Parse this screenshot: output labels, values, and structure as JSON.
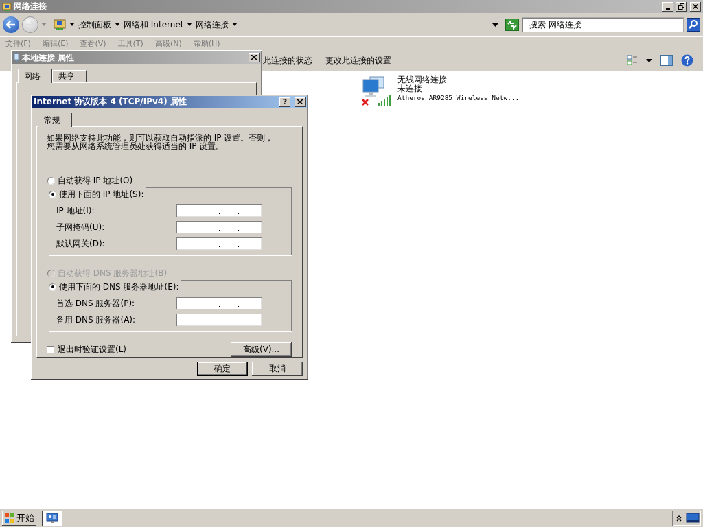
{
  "window": {
    "title": "网络连接"
  },
  "address_bar": {
    "breadcrumbs": [
      "控制面板",
      "网络和 Internet",
      "网络连接"
    ]
  },
  "search": {
    "placeholder": "搜索 网络连接"
  },
  "menu": [
    {
      "label": "文件(F)",
      "disabled": true
    },
    {
      "label": "编辑(E)",
      "disabled": true
    },
    {
      "label": "查看(V)",
      "disabled": true
    },
    {
      "label": "工具(T)",
      "disabled": true
    },
    {
      "label": "高级(N)",
      "disabled": true
    },
    {
      "label": "帮助(H)",
      "disabled": true
    }
  ],
  "command_bar": [
    "此连接的状态",
    "更改此连接的设置"
  ],
  "connections": [
    {
      "name": "无线网络连接",
      "status": "未连接",
      "device": "Atheros AR9285 Wireless Netw...",
      "connected": false
    }
  ],
  "back_dialog": {
    "title": "本地连接 属性",
    "tabs": [
      {
        "label": "网络",
        "selected": true
      },
      {
        "label": "共享",
        "selected": false
      }
    ]
  },
  "dialog": {
    "title": "Internet 协议版本 4 (TCP/IPv4) 属性",
    "help": "?",
    "tabs": [
      {
        "label": "常规",
        "selected": true
      }
    ],
    "description": [
      "如果网络支持此功能，则可以获取自动指派的 IP 设置。否则，",
      "您需要从网络系统管理员处获得适当的 IP 设置。"
    ],
    "sections": [
      {
        "auto": {
          "label": "自动获得 IP 地址(O)",
          "selected": false,
          "disabled": false
        },
        "manual": {
          "label": "使用下面的 IP 地址(S):",
          "selected": true
        },
        "fields": [
          {
            "label": "IP 地址(I):"
          },
          {
            "label": "子网掩码(U):"
          },
          {
            "label": "默认网关(D):"
          }
        ]
      },
      {
        "auto": {
          "label": "自动获得 DNS 服务器地址(B)",
          "selected": false,
          "disabled": true
        },
        "manual": {
          "label": "使用下面的 DNS 服务器地址(E):",
          "selected": true
        },
        "fields": [
          {
            "label": "首选 DNS 服务器(P):"
          },
          {
            "label": "备用 DNS 服务器(A):"
          }
        ]
      }
    ],
    "checkbox": {
      "label": "退出时验证设置(L)",
      "checked": false
    },
    "advanced_button": "高级(V)...",
    "buttons": [
      {
        "label": "确定",
        "default": true
      },
      {
        "label": "取消",
        "default": false
      }
    ]
  },
  "taskbar": {
    "start": "开始"
  }
}
